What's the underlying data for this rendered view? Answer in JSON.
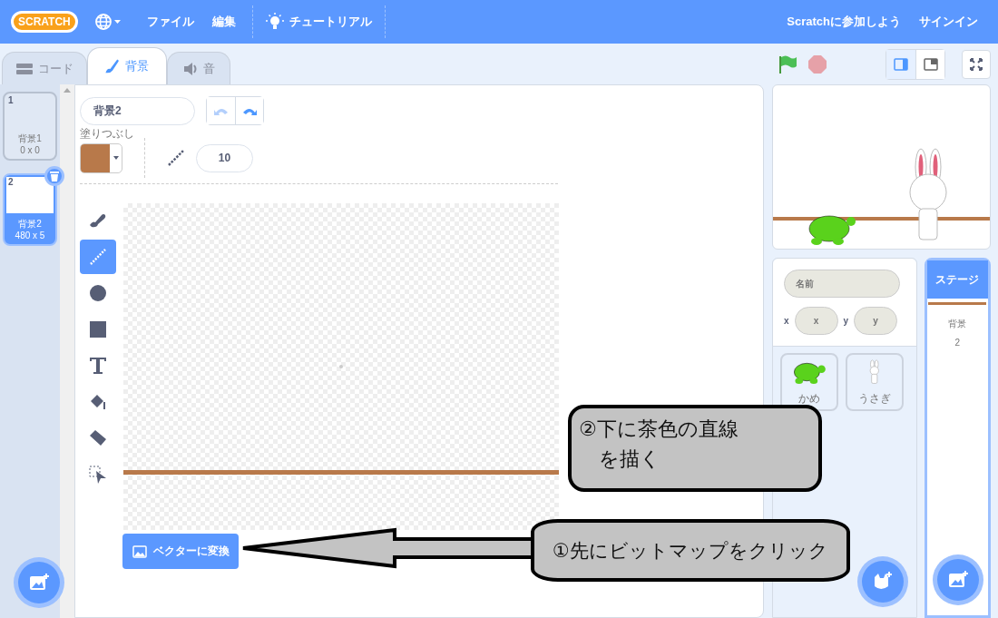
{
  "menubar": {
    "logo": "SCRATCH",
    "menus": [
      "ファイル",
      "編集"
    ],
    "tutorials": "チュートリアル",
    "join": "Scratchに参加しよう",
    "signin": "サインイン"
  },
  "tabs": [
    {
      "label": "コード",
      "selected": false
    },
    {
      "label": "背景",
      "selected": true
    },
    {
      "label": "音",
      "selected": false
    }
  ],
  "costumes": [
    {
      "number": "1",
      "name": "背景1",
      "size": "0 x 0",
      "selected": false
    },
    {
      "number": "2",
      "name": "背景2",
      "size": "480 x 5",
      "selected": true
    }
  ],
  "editor": {
    "costume_name": "背景2",
    "fill": {
      "label": "塗りつぶし",
      "color": "#b8794a"
    },
    "brush_size": "10",
    "tools": [
      {
        "kind": "brush",
        "selected": false
      },
      {
        "kind": "line",
        "selected": true
      },
      {
        "kind": "circle",
        "selected": false
      },
      {
        "kind": "rect",
        "selected": false
      },
      {
        "kind": "text",
        "selected": false
      },
      {
        "kind": "fill",
        "selected": false
      },
      {
        "kind": "eraser",
        "selected": false
      },
      {
        "kind": "select",
        "selected": false
      }
    ],
    "convert_button": "ベクターに変換"
  },
  "sprite_info": {
    "name_placeholder": "名前",
    "x_label": "x",
    "x_placeholder": "x",
    "y_label": "y",
    "y_placeholder": "y"
  },
  "sprites": [
    {
      "name": "かめ",
      "kind": "turtle",
      "selected": false
    },
    {
      "name": "うさぎ",
      "kind": "rabbit",
      "selected": false
    }
  ],
  "stage_pane": {
    "header": "ステージ",
    "backdrops_label": "背景",
    "backdrops_count": "2"
  },
  "annotations": [
    {
      "lines": [
        "②下に茶色の直線",
        "を描く"
      ]
    },
    {
      "lines": [
        "①先にビットマップをクリック"
      ]
    }
  ]
}
